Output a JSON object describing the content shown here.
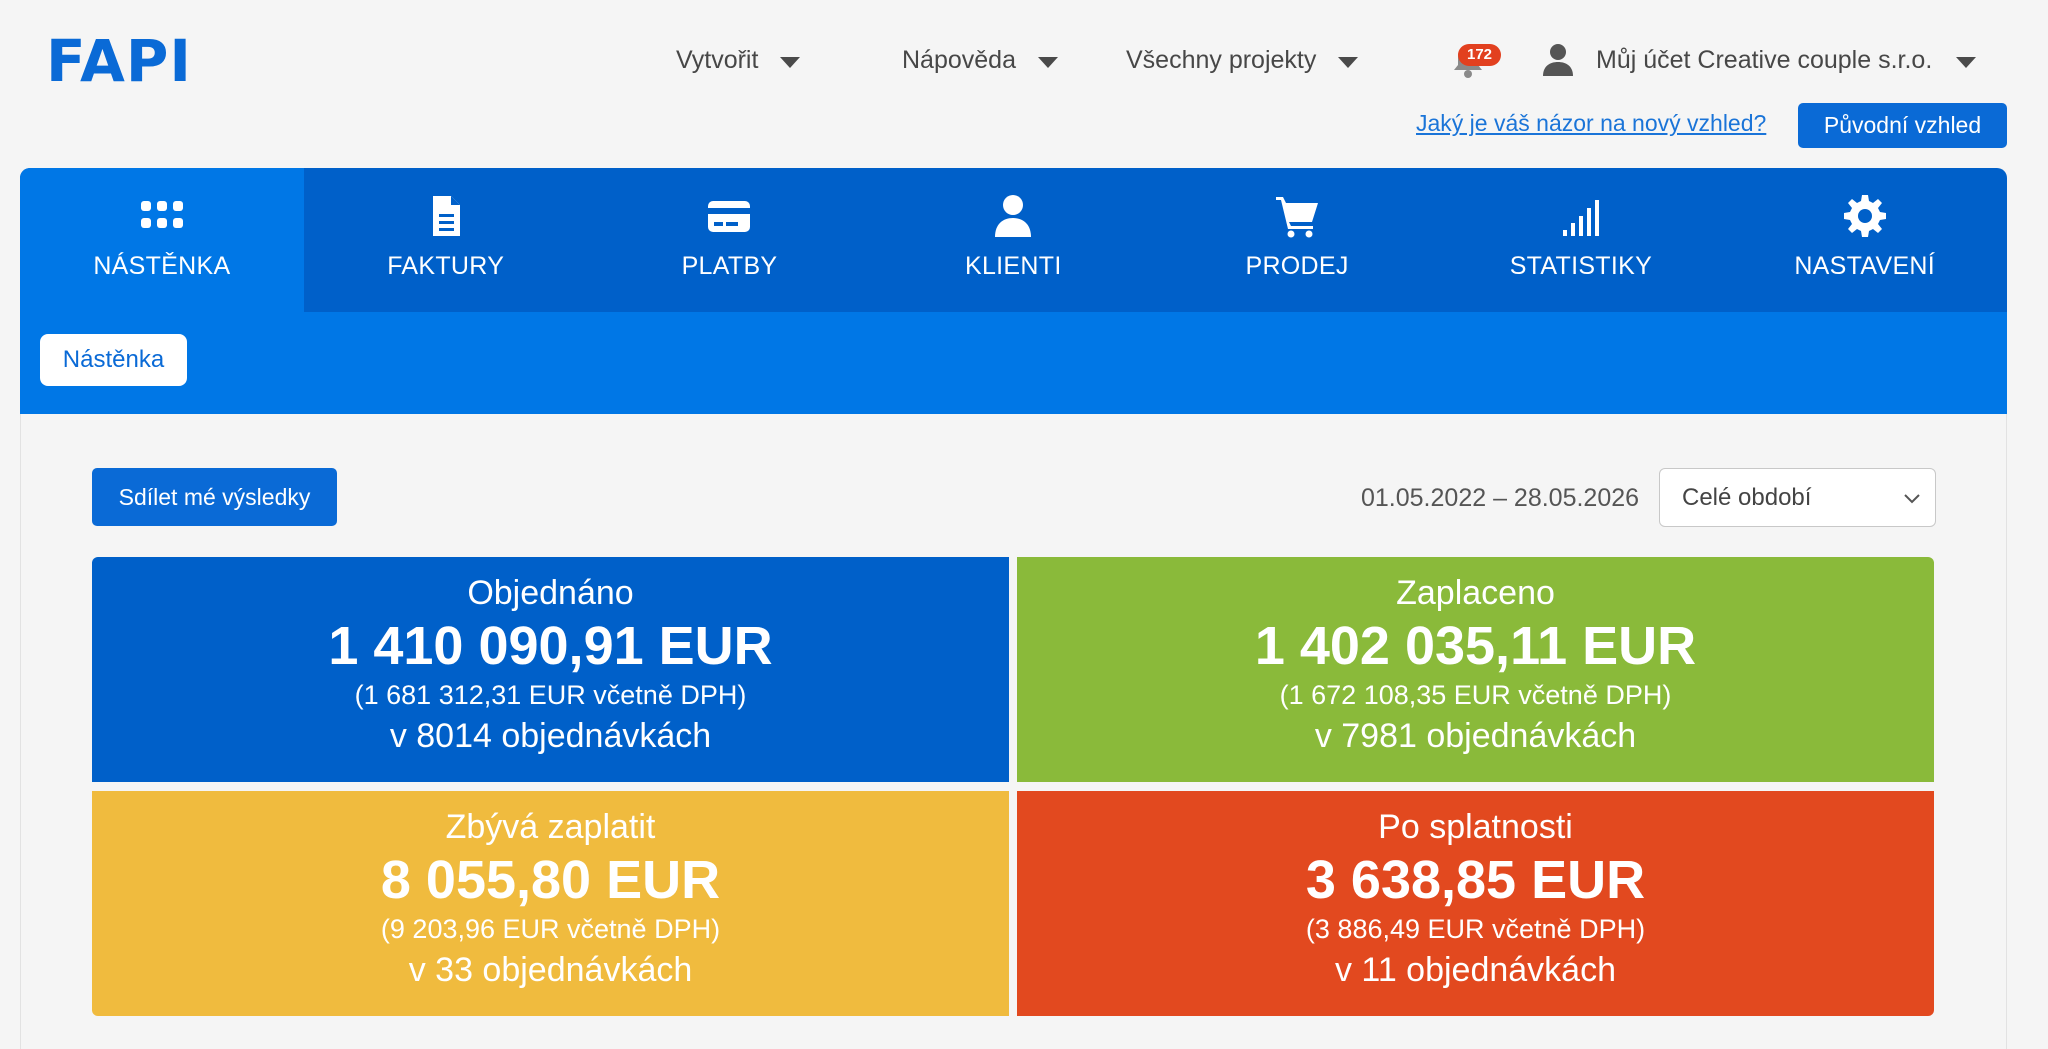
{
  "brand": {
    "logo": "FAPI",
    "color": "#0a6ad6"
  },
  "header": {
    "menu": [
      {
        "label": "Vytvořit"
      },
      {
        "label": "Nápověda"
      },
      {
        "label": "Všechny projekty"
      }
    ],
    "notifications": {
      "count": "172"
    },
    "account": {
      "label": "Můj účet Creative couple s.r.o."
    },
    "feedback_link": "Jaký je váš názor na nový vzhled?",
    "original_view_button": "Původní vzhled"
  },
  "main_nav": {
    "tabs": [
      {
        "label": "NÁSTĚNKA",
        "icon": "grid-icon",
        "active": true
      },
      {
        "label": "FAKTURY",
        "icon": "document-icon"
      },
      {
        "label": "PLATBY",
        "icon": "credit-card-icon"
      },
      {
        "label": "KLIENTI",
        "icon": "user-icon"
      },
      {
        "label": "PRODEJ",
        "icon": "cart-icon"
      },
      {
        "label": "STATISTIKY",
        "icon": "signal-bars-icon"
      },
      {
        "label": "NASTAVENÍ",
        "icon": "gear-icon"
      }
    ]
  },
  "sub_nav": {
    "active": "Nástěnka"
  },
  "dashboard": {
    "share_button": "Sdílet mé výsledky",
    "date_range": "01.05.2022 – 28.05.2026",
    "period_select": {
      "value": "Celé období"
    },
    "cards": {
      "ordered": {
        "title": "Objednáno",
        "amount": "1 410 090,91 EUR",
        "vat": "(1 681 312,31 EUR včetně DPH)",
        "orders": "v 8014 objednávkách",
        "color": "#0060c9"
      },
      "paid": {
        "title": "Zaplaceno",
        "amount": "1 402 035,11 EUR",
        "vat": "(1 672 108,35 EUR včetně DPH)",
        "orders": "v 7981 objednávkách",
        "color": "#8aba3a"
      },
      "remaining": {
        "title": "Zbývá zaplatit",
        "amount": "8 055,80 EUR",
        "vat": "(9 203,96 EUR včetně DPH)",
        "orders": "v 33 objednávkách",
        "color": "#f0bb3e"
      },
      "overdue": {
        "title": "Po splatnosti",
        "amount": "3 638,85 EUR",
        "vat": "(3 886,49 EUR včetně DPH)",
        "orders": "v 11 objednávkách",
        "color": "#e2491f"
      }
    }
  }
}
